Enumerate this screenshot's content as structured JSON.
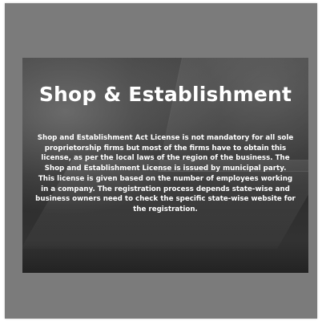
{
  "card": {
    "title": "Shop & Establishment",
    "paragraph_1": "Shop and Establishment Act License is not mandatory for all sole proprietorship firms but most of the firms have to obtain this license, as per the local laws of the region of the business. The Shop and Establishment License is issued by municipal party.",
    "paragraph_2": "This license is given based on the number of employees working in a company. The registration process depends state-wise and business owners need to check the specific state-wise website for the registration."
  },
  "colors": {
    "frame_background": "#7b7b7b",
    "text": "#ffffff",
    "photo_dark": "#2c2c2c"
  }
}
